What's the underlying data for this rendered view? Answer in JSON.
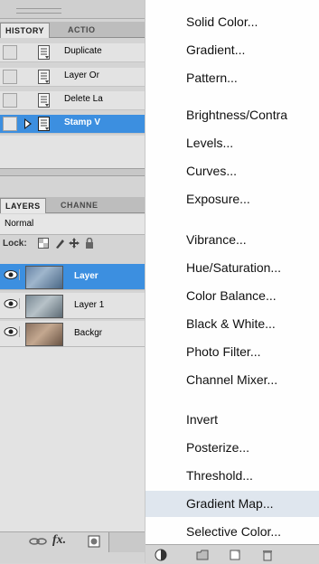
{
  "history_panel": {
    "tabs": [
      {
        "label": "HISTORY",
        "active": true
      },
      {
        "label": "ACTIO",
        "active": false
      }
    ],
    "items": [
      {
        "label": "Duplicate",
        "selected": false
      },
      {
        "label": "Layer Or",
        "selected": false
      },
      {
        "label": "Delete La",
        "selected": false
      },
      {
        "label": "Stamp V",
        "selected": true
      }
    ]
  },
  "layers_panel": {
    "tabs": [
      {
        "label": "LAYERS",
        "active": true
      },
      {
        "label": "CHANNE",
        "active": false
      }
    ],
    "blend_mode": "Normal",
    "lock_label": "Lock:",
    "layers": [
      {
        "label": "Layer",
        "selected": true
      },
      {
        "label": "Layer 1",
        "selected": false
      },
      {
        "label": "Backgr",
        "selected": false
      }
    ],
    "fx_label": "fx."
  },
  "adjustment_menu": {
    "items": [
      {
        "label": "Solid Color...",
        "highlighted": false
      },
      {
        "label": "Gradient...",
        "highlighted": false
      },
      {
        "label": "Pattern...",
        "highlighted": false
      },
      {
        "label": "Brightness/Contra",
        "highlighted": false
      },
      {
        "label": "Levels...",
        "highlighted": false
      },
      {
        "label": "Curves...",
        "highlighted": false
      },
      {
        "label": "Exposure...",
        "highlighted": false
      },
      {
        "label": "Vibrance...",
        "highlighted": false
      },
      {
        "label": "Hue/Saturation...",
        "highlighted": false
      },
      {
        "label": "Color Balance...",
        "highlighted": false
      },
      {
        "label": "Black & White...",
        "highlighted": false
      },
      {
        "label": "Photo Filter...",
        "highlighted": false
      },
      {
        "label": "Channel Mixer...",
        "highlighted": false
      },
      {
        "label": "Invert",
        "highlighted": false
      },
      {
        "label": "Posterize...",
        "highlighted": false
      },
      {
        "label": "Threshold...",
        "highlighted": false
      },
      {
        "label": "Gradient Map...",
        "highlighted": true
      },
      {
        "label": "Selective Color...",
        "highlighted": false
      }
    ]
  },
  "colors": {
    "selection_blue": "#3c8fe0",
    "menu_highlight": "#dfe6ee"
  }
}
